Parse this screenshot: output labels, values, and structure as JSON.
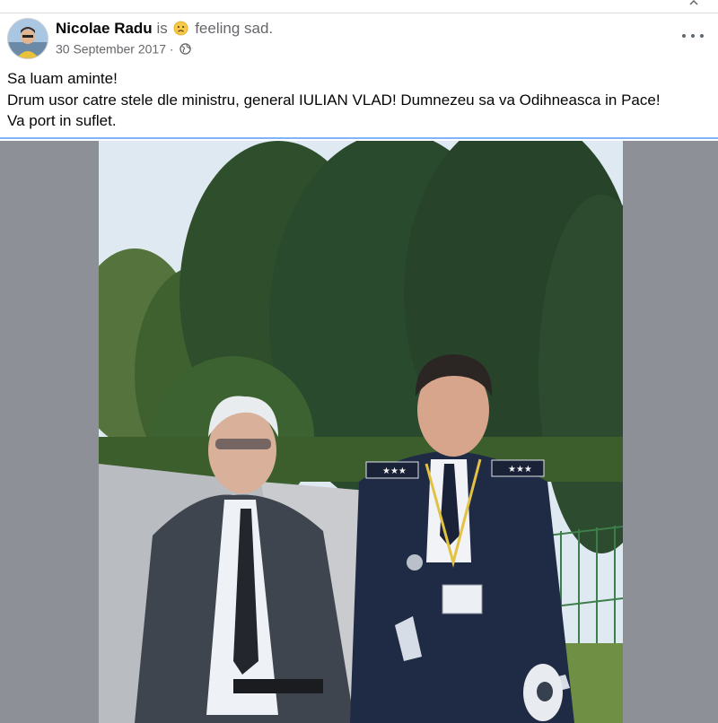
{
  "post": {
    "author": "Nicolae Radu",
    "is_word": "is",
    "feeling_emoji": "sad-face-icon",
    "feeling": "feeling sad.",
    "date": "30 September 2017",
    "date_separator": "·",
    "privacy_icon": "globe-icon",
    "more_icon": "more-options-icon",
    "text_lines": [
      "Sa luam aminte!",
      "Drum usor catre stele dle ministru, general IULIAN VLAD! Dumnezeu sa va Odihneasca in Pace!",
      "Va port in suflet."
    ]
  },
  "photo": {
    "description_icon": "post-photo",
    "uniform_shoulder_marks": "★★★"
  },
  "colors": {
    "accent": "#1877f2",
    "secondary_text": "#65676b",
    "photo_backdrop": "#8e9097"
  }
}
